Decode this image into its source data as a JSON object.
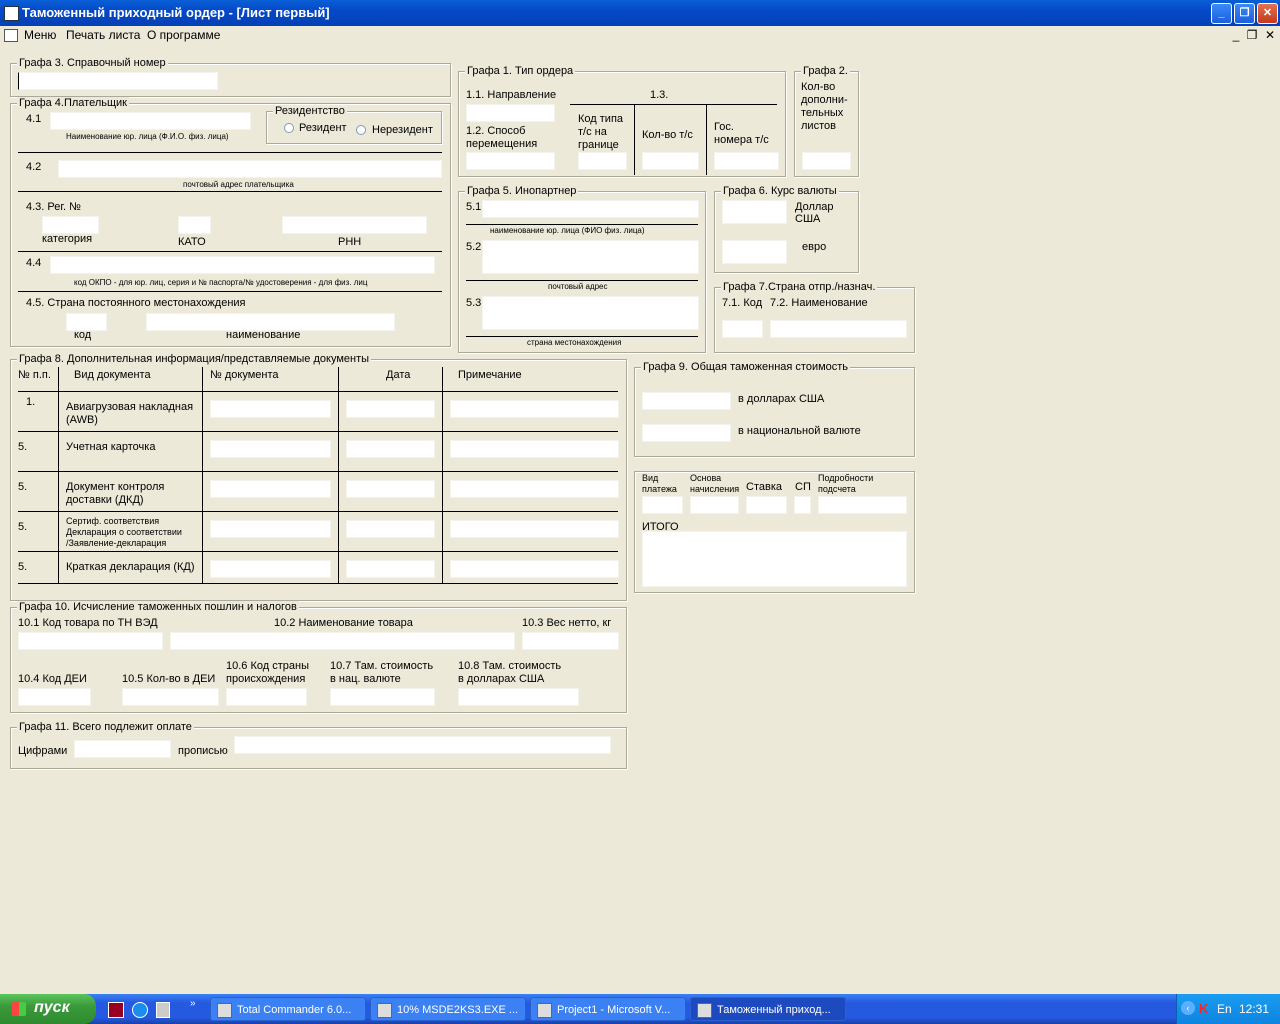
{
  "window": {
    "title": "Таможенный приходный ордер - [Лист первый]",
    "btn_min": "_",
    "btn_max": "❐",
    "btn_close": "✕"
  },
  "menu": {
    "items": [
      "Меню",
      "Печать листа",
      "О программе"
    ],
    "mdi_min": "_",
    "mdi_restore": "❐",
    "mdi_close": "✕"
  },
  "g3": {
    "title": "Графа 3. Справочный номер"
  },
  "g4": {
    "title": "Графа 4.Плательщик",
    "l41": "4.1",
    "cap41": "Наименование юр. лица (Ф.И.О. физ. лица)",
    "residency_title": "Резидентство",
    "resident": "Резидент",
    "nonresident": "Нерезидент",
    "l42": "4.2",
    "cap42": "почтовый адрес плательщика",
    "l43": "4.3. Рег. №",
    "category": "категория",
    "kato": "КАТО",
    "rnn": "РНН",
    "l44": "4.4",
    "cap44": "код ОКПО - для юр. лиц, серия и № паспорта/№ удостоверения - для физ. лиц",
    "l45": "4.5. Страна постоянного местонахождения",
    "code": "код",
    "name": "наименование"
  },
  "g1": {
    "title": "Графа 1. Тип ордера",
    "l11": "1.1. Направление",
    "l13": "1.3.",
    "l12a": "1.2. Способ",
    "l12b": "перемещения",
    "code_type_a": "Код типа",
    "code_type_b": "т/с на",
    "code_type_c": "границе",
    "qty": "Кол-во т/с",
    "gos_a": "Гос.",
    "gos_b": "номера т/с"
  },
  "g2": {
    "title": "Графа 2.",
    "lines": [
      "Кол-во",
      "дополни-",
      "тельных",
      "листов"
    ]
  },
  "g5": {
    "title": "Графа 5. Инопартнер",
    "l51": "5.1",
    "cap51": "наименование юр. лица (ФИО физ. лица)",
    "l52": "5.2",
    "cap52": "почтовый адрес",
    "l53": "5.3",
    "cap53": "страна местонахождения"
  },
  "g6": {
    "title": "Графа 6. Курс валюты",
    "usd_a": "Доллар",
    "usd_b": "США",
    "eur": "евро"
  },
  "g7": {
    "title": "Графа 7.Страна отпр./назнач.",
    "l71": "7.1. Код",
    "l72": "7.2. Наименование"
  },
  "g8": {
    "title": "Графа 8. Дополнительная информация/представляемые документы",
    "headers": [
      "№ п.п.",
      "Вид документа",
      "№ документа",
      "Дата",
      "Примечание"
    ],
    "rows": [
      {
        "num": "1.",
        "doc": [
          "Авиагрузовая накладная",
          "(AWB)"
        ]
      },
      {
        "num": "5.",
        "doc": [
          "Учетная карточка"
        ]
      },
      {
        "num": "5.",
        "doc": [
          "Документ контроля",
          "доставки (ДКД)"
        ]
      },
      {
        "num": "5.",
        "doc": [
          "Сертиф. соответствия",
          "Декларация о соответствии",
          "/Заявление-декларация"
        ]
      },
      {
        "num": "5.",
        "doc": [
          "Краткая декларация (КД)"
        ]
      }
    ]
  },
  "g9": {
    "title": "Графа 9. Общая таможенная стоимость",
    "usd": "в долларах США",
    "nat": "в национальной валюте"
  },
  "pay": {
    "h1a": "Вид",
    "h1b": "платежа",
    "h2a": "Основа",
    "h2b": "начисления",
    "h3": "Ставка",
    "h4": "СП",
    "h5a": "Подробности",
    "h5b": "подсчета",
    "total": "ИТОГО"
  },
  "g10": {
    "title": "Графа 10. Исчисление таможенных пошлин и налогов",
    "l101": "10.1 Код товара по ТН ВЭД",
    "l102": "10.2 Наименование товара",
    "l103": "10.3 Вес нетто, кг",
    "l104": "10.4 Код ДЕИ",
    "l105": "10.5 Кол-во в ДЕИ",
    "l106a": "10.6 Код страны",
    "l106b": "происхождения",
    "l107a": "10.7 Там. стоимость",
    "l107b": "в нац. валюте",
    "l108a": "10.8 Там. стоимость",
    "l108b": "в долларах США"
  },
  "g11": {
    "title": "Графа 11. Всего подлежит оплате",
    "digits": "Цифрами",
    "words": "прописью"
  },
  "taskbar": {
    "start": "пуск",
    "tasks": [
      "Total Commander 6.0...",
      "10% MSDE2KS3.EXE ...",
      "Project1 - Microsoft V...",
      "Таможенный приход..."
    ],
    "lang": "En",
    "time": "12:31"
  }
}
